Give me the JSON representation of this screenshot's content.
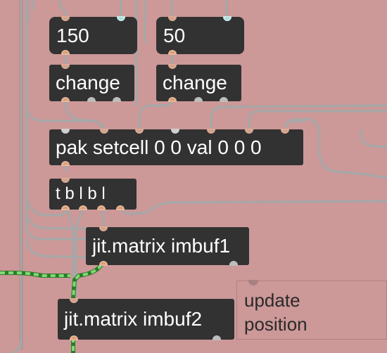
{
  "patcher": {
    "background_color": "#cc9898",
    "cord_color": "#a7a7a7",
    "signal_cord_color": "#7fdc71"
  },
  "objects": {
    "msg_150": {
      "kind": "message",
      "text": "150"
    },
    "msg_50": {
      "kind": "message",
      "text": "50"
    },
    "change_1": {
      "kind": "object",
      "text": "change"
    },
    "change_2": {
      "kind": "object",
      "text": "change"
    },
    "pak": {
      "kind": "object",
      "text": "pak setcell 0 0 val 0 0 0"
    },
    "trigger": {
      "kind": "object",
      "text": "t b l b l"
    },
    "imbuf1": {
      "kind": "object",
      "text": "jit.matrix imbuf1"
    },
    "imbuf2": {
      "kind": "object",
      "text": "jit.matrix imbuf2"
    }
  },
  "comment": {
    "line1": "update",
    "line2": "position"
  },
  "icons": {
    "inlet": "inlet-dot-icon",
    "outlet": "outlet-dot-icon"
  }
}
